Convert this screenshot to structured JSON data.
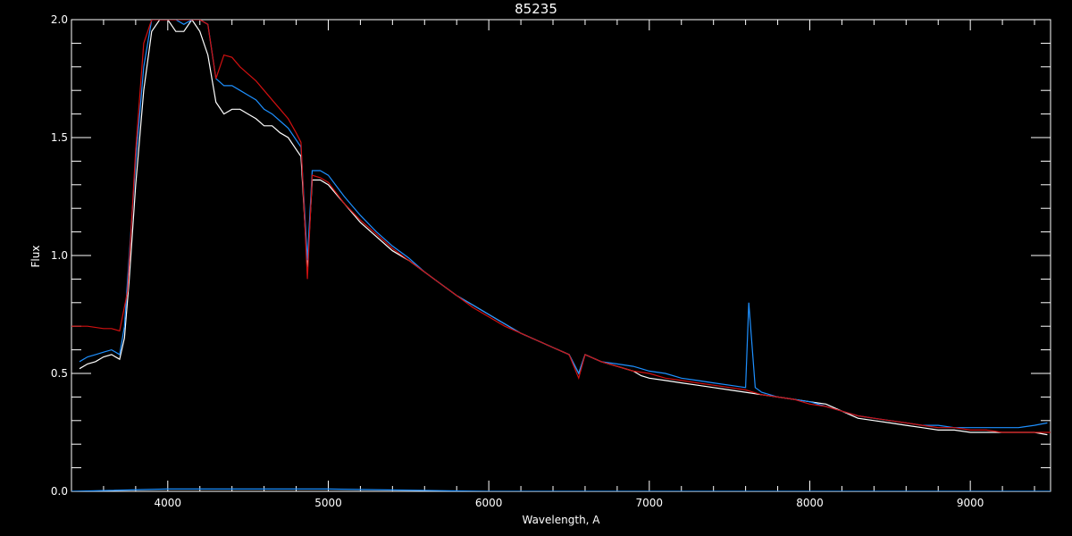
{
  "chart_data": {
    "type": "line",
    "title": "85235",
    "xlabel": "Wavelength, A",
    "ylabel": "Flux",
    "xlim": [
      3400,
      9500
    ],
    "ylim": [
      0.0,
      2.0
    ],
    "xticks": [
      4000,
      5000,
      6000,
      7000,
      8000,
      9000
    ],
    "ytick_labels": [
      "0.0",
      "0.5",
      "1.0",
      "1.5",
      "2.0"
    ],
    "yticks": [
      0.0,
      0.5,
      1.0,
      1.5,
      2.0
    ],
    "grid": false,
    "series": [
      {
        "color": "#ffffff",
        "x": [
          3450,
          3500,
          3550,
          3600,
          3650,
          3700,
          3730,
          3760,
          3800,
          3850,
          3900,
          3950,
          4000,
          4050,
          4100,
          4150,
          4200,
          4250,
          4300,
          4350,
          4400,
          4450,
          4500,
          4550,
          4600,
          4650,
          4700,
          4750,
          4800,
          4830,
          4870,
          4900,
          4950,
          5000,
          5100,
          5200,
          5300,
          5400,
          5500,
          5600,
          5700,
          5800,
          5900,
          6000,
          6100,
          6200,
          6300,
          6400,
          6500,
          6560,
          6600,
          6700,
          6800,
          6900,
          6950,
          7000,
          7100,
          7200,
          7300,
          7400,
          7500,
          7600,
          7700,
          7800,
          7900,
          8000,
          8100,
          8200,
          8300,
          8400,
          8500,
          8600,
          8700,
          8800,
          8900,
          9000,
          9100,
          9200,
          9300,
          9400,
          9480
        ],
        "y": [
          0.52,
          0.54,
          0.55,
          0.57,
          0.58,
          0.56,
          0.65,
          0.9,
          1.3,
          1.7,
          1.95,
          2.0,
          2.0,
          1.95,
          1.95,
          2.0,
          1.95,
          1.85,
          1.65,
          1.6,
          1.62,
          1.62,
          1.6,
          1.58,
          1.55,
          1.55,
          1.52,
          1.5,
          1.45,
          1.42,
          0.95,
          1.32,
          1.32,
          1.3,
          1.22,
          1.14,
          1.08,
          1.02,
          0.98,
          0.93,
          0.88,
          0.83,
          0.79,
          0.75,
          0.71,
          0.67,
          0.64,
          0.61,
          0.58,
          0.5,
          0.58,
          0.55,
          0.53,
          0.51,
          0.49,
          0.48,
          0.47,
          0.46,
          0.45,
          0.44,
          0.43,
          0.42,
          0.41,
          0.4,
          0.39,
          0.38,
          0.37,
          0.34,
          0.31,
          0.3,
          0.29,
          0.28,
          0.27,
          0.26,
          0.26,
          0.25,
          0.25,
          0.25,
          0.25,
          0.25,
          0.24
        ]
      },
      {
        "color": "#1e90ff",
        "x": [
          3450,
          3500,
          3550,
          3600,
          3650,
          3700,
          3730,
          3760,
          3800,
          3850,
          3900,
          3950,
          4000,
          4050,
          4100,
          4150,
          4200,
          4250,
          4300,
          4350,
          4400,
          4450,
          4500,
          4550,
          4600,
          4650,
          4700,
          4750,
          4800,
          4830,
          4870,
          4900,
          4950,
          5000,
          5100,
          5200,
          5300,
          5400,
          5500,
          5600,
          5700,
          5800,
          5900,
          6000,
          6100,
          6200,
          6300,
          6400,
          6500,
          6560,
          6600,
          6700,
          6800,
          6900,
          6950,
          7000,
          7100,
          7200,
          7300,
          7400,
          7500,
          7600,
          7620,
          7660,
          7700,
          7800,
          7900,
          8000,
          8100,
          8200,
          8300,
          8400,
          8500,
          8600,
          8700,
          8800,
          8900,
          9000,
          9100,
          9200,
          9300,
          9400,
          9480
        ],
        "y": [
          0.55,
          0.57,
          0.58,
          0.59,
          0.6,
          0.58,
          0.7,
          1.0,
          1.4,
          1.8,
          2.0,
          2.0,
          2.0,
          2.0,
          1.98,
          2.0,
          2.0,
          1.98,
          1.75,
          1.72,
          1.72,
          1.7,
          1.68,
          1.66,
          1.62,
          1.6,
          1.57,
          1.54,
          1.49,
          1.46,
          0.98,
          1.36,
          1.36,
          1.34,
          1.25,
          1.17,
          1.1,
          1.04,
          0.99,
          0.93,
          0.88,
          0.83,
          0.79,
          0.75,
          0.71,
          0.67,
          0.64,
          0.61,
          0.58,
          0.5,
          0.58,
          0.55,
          0.54,
          0.53,
          0.52,
          0.51,
          0.5,
          0.48,
          0.47,
          0.46,
          0.45,
          0.44,
          0.8,
          0.44,
          0.42,
          0.4,
          0.39,
          0.38,
          0.36,
          0.34,
          0.32,
          0.31,
          0.3,
          0.29,
          0.28,
          0.28,
          0.27,
          0.27,
          0.27,
          0.27,
          0.27,
          0.28,
          0.29
        ]
      },
      {
        "color": "#d01010",
        "x": [
          3400,
          3500,
          3600,
          3650,
          3700,
          3750,
          3800,
          3850,
          3900,
          3950,
          4000,
          4050,
          4100,
          4150,
          4200,
          4250,
          4300,
          4350,
          4400,
          4450,
          4500,
          4550,
          4600,
          4650,
          4700,
          4750,
          4800,
          4830,
          4870,
          4900,
          4950,
          5000,
          5100,
          5200,
          5300,
          5400,
          5500,
          5600,
          5700,
          5800,
          5900,
          6000,
          6100,
          6200,
          6300,
          6400,
          6500,
          6560,
          6600,
          6700,
          6800,
          6900,
          7000,
          7100,
          7200,
          7300,
          7400,
          7500,
          7600,
          7700,
          7800,
          7900,
          8000,
          8100,
          8200,
          8300,
          8400,
          8500,
          8600,
          8700,
          8800,
          8900,
          9000,
          9100,
          9200,
          9300,
          9400,
          9500
        ],
        "y": [
          0.7,
          0.7,
          0.69,
          0.69,
          0.68,
          0.85,
          1.45,
          1.9,
          2.0,
          2.0,
          2.0,
          2.0,
          2.0,
          2.0,
          2.0,
          1.98,
          1.75,
          1.85,
          1.84,
          1.8,
          1.77,
          1.74,
          1.7,
          1.66,
          1.62,
          1.58,
          1.52,
          1.48,
          0.9,
          1.34,
          1.33,
          1.31,
          1.22,
          1.15,
          1.09,
          1.03,
          0.98,
          0.93,
          0.88,
          0.83,
          0.78,
          0.74,
          0.7,
          0.67,
          0.64,
          0.61,
          0.58,
          0.48,
          0.58,
          0.55,
          0.53,
          0.51,
          0.5,
          0.48,
          0.47,
          0.46,
          0.45,
          0.44,
          0.43,
          0.41,
          0.4,
          0.39,
          0.37,
          0.36,
          0.34,
          0.32,
          0.31,
          0.3,
          0.29,
          0.28,
          0.27,
          0.27,
          0.26,
          0.26,
          0.25,
          0.25,
          0.25,
          0.25
        ]
      },
      {
        "color": "#1e90ff",
        "x": [
          3400,
          4000,
          5000,
          6000,
          7000,
          8000,
          9000,
          9500
        ],
        "y": [
          0.0,
          0.01,
          0.01,
          0.0,
          0.0,
          0.0,
          0.0,
          0.0
        ]
      }
    ]
  }
}
